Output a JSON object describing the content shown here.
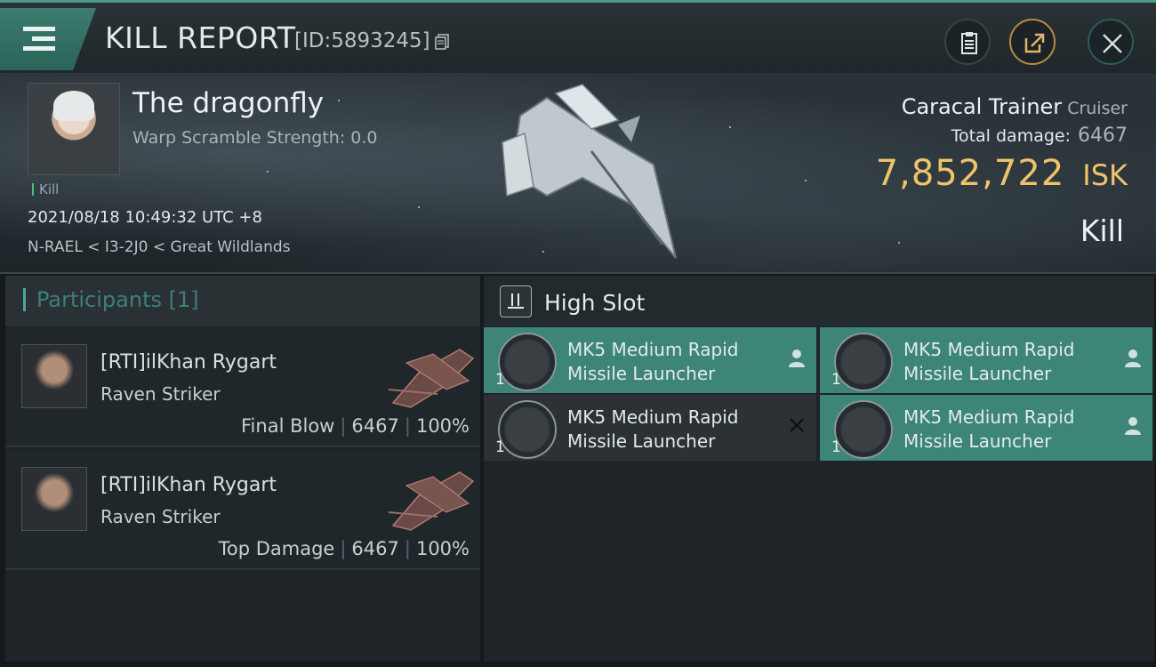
{
  "window": {
    "title": "KILL REPORT",
    "report_id": "[ID:5893245]"
  },
  "header": {
    "pilot_name": "The dragonfly",
    "warp_scramble": "Warp Scramble Strength: 0.0",
    "kill_tag": "Kill",
    "datetime": "2021/08/18 10:49:32 UTC +8",
    "location": "N-RAEL < I3-2J0 < Great Wildlands",
    "ship_name": "Caracal Trainer",
    "ship_class": "Cruiser",
    "total_damage_label": "Total damage:",
    "total_damage_value": "6467",
    "isk_value": "7,852,722",
    "isk_unit": "ISK",
    "result": "Kill"
  },
  "participants": {
    "title": "Participants [1]",
    "items": [
      {
        "name": "[RTI]ilKhan Rygart",
        "ship": "Raven Striker",
        "role": "Final Blow",
        "damage": "6467",
        "percent": "100%"
      },
      {
        "name": "[RTI]ilKhan Rygart",
        "ship": "Raven Striker",
        "role": "Top Damage",
        "damage": "6467",
        "percent": "100%"
      }
    ]
  },
  "fitting": {
    "slot_title": "High Slot",
    "modules": [
      {
        "name_line1": "MK5 Medium Rapid",
        "name_line2": "Missile Launcher",
        "qty": "1",
        "status": "fitted",
        "status_icon": "person-icon"
      },
      {
        "name_line1": "MK5 Medium Rapid",
        "name_line2": "Missile Launcher",
        "qty": "1",
        "status": "fitted",
        "status_icon": "person-icon"
      },
      {
        "name_line1": "MK5 Medium Rapid",
        "name_line2": "Missile Launcher",
        "qty": "1",
        "status": "destroyed",
        "status_icon": "x-icon"
      },
      {
        "name_line1": "MK5 Medium Rapid",
        "name_line2": "Missile Launcher",
        "qty": "1",
        "status": "fitted",
        "status_icon": "person-icon"
      }
    ]
  },
  "colors": {
    "accent": "#3d8576",
    "isk": "#f0c36a",
    "kill_tag": "#4ec07a"
  }
}
